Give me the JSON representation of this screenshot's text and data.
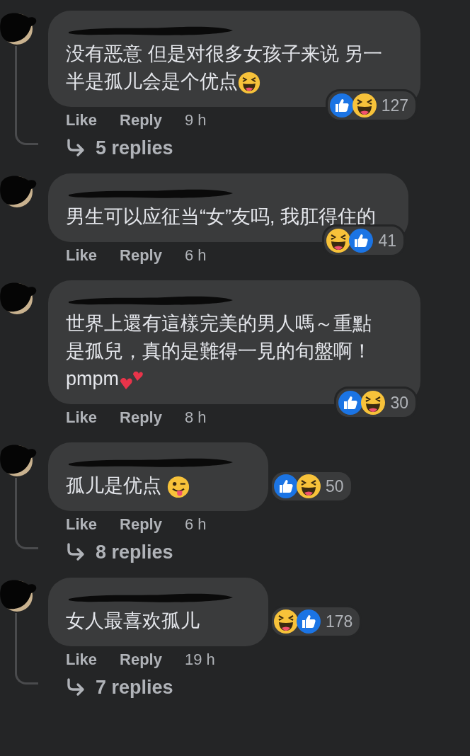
{
  "comments": [
    {
      "text": "没有恶意 但是对很多女孩子来说 另一半是孤儿会是个优点",
      "emoji": {
        "kind": "grin"
      },
      "reactions": [
        {
          "kind": "like"
        },
        {
          "kind": "haha"
        }
      ],
      "reaction_count": "127",
      "actions": {
        "like": "Like",
        "reply": "Reply",
        "time": "9 h"
      },
      "replies": "5 replies"
    },
    {
      "text": "男生可以应征当“女”友吗, 我肛得住的",
      "reactions": [
        {
          "kind": "haha"
        },
        {
          "kind": "like"
        }
      ],
      "reaction_count": "41",
      "actions": {
        "like": "Like",
        "reply": "Reply",
        "time": "6 h"
      }
    },
    {
      "text": "世界上還有這樣完美的男人嗎～重點是孤兒，真的是難得一見的旬盤啊！pmpm",
      "emoji": {
        "kind": "hearts"
      },
      "reactions": [
        {
          "kind": "like"
        },
        {
          "kind": "haha"
        }
      ],
      "reaction_count": "30",
      "actions": {
        "like": "Like",
        "reply": "Reply",
        "time": "8 h"
      }
    },
    {
      "text": "孤儿是优点",
      "emoji": {
        "kind": "wink"
      },
      "reactions": [
        {
          "kind": "like"
        },
        {
          "kind": "haha"
        }
      ],
      "reaction_count": "50",
      "actions": {
        "like": "Like",
        "reply": "Reply",
        "time": "6 h"
      },
      "replies": "8 replies"
    },
    {
      "text": "女人最喜欢孤儿",
      "reactions": [
        {
          "kind": "haha"
        },
        {
          "kind": "like"
        }
      ],
      "reaction_count": "178",
      "actions": {
        "like": "Like",
        "reply": "Reply",
        "time": "19 h"
      },
      "replies": "7 replies"
    }
  ]
}
